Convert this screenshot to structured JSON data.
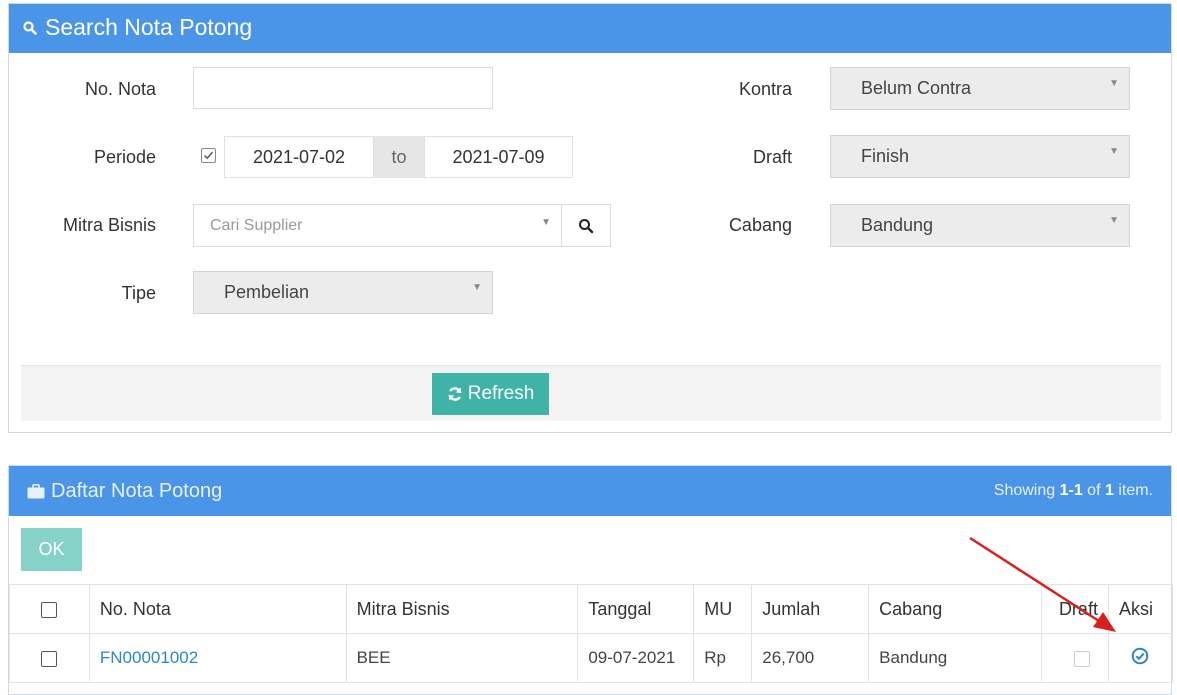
{
  "search_panel": {
    "title": "Search Nota Potong",
    "icon": "search-icon",
    "fields": {
      "no_nota": {
        "label": "No. Nota",
        "value": ""
      },
      "periode": {
        "label": "Periode",
        "checked": true,
        "from": "2021-07-02",
        "to_label": "to",
        "to": "2021-07-09"
      },
      "mitra_bisnis": {
        "label": "Mitra Bisnis",
        "placeholder": "Cari Supplier"
      },
      "tipe": {
        "label": "Tipe",
        "value": "Pembelian"
      },
      "kontra": {
        "label": "Kontra",
        "value": "Belum Contra"
      },
      "draft": {
        "label": "Draft",
        "value": "Finish"
      },
      "cabang": {
        "label": "Cabang",
        "value": "Bandung"
      }
    },
    "refresh_label": "Refresh"
  },
  "list_panel": {
    "title": "Daftar Nota Potong",
    "icon": "briefcase-icon",
    "summary_prefix": "Showing ",
    "summary_range": "1-1",
    "summary_mid": " of ",
    "summary_total": "1",
    "summary_suffix": " item.",
    "ok_label": "OK",
    "columns": [
      "No. Nota",
      "Mitra Bisnis",
      "Tanggal",
      "MU",
      "Jumlah",
      "Cabang",
      "Draft",
      "Aksi"
    ],
    "rows": [
      {
        "no_nota": "FN00001002",
        "mitra_bisnis": "BEE",
        "tanggal": "09-07-2021",
        "mu": "Rp",
        "jumlah": "26,700",
        "cabang": "Bandung",
        "draft": false
      }
    ]
  },
  "colors": {
    "header_blue": "#4b95e8",
    "refresh_teal": "#3fb3a5",
    "ok_teal_light": "#86d1c8",
    "arrow_red": "#d92020",
    "link_blue": "#2f86c5"
  }
}
